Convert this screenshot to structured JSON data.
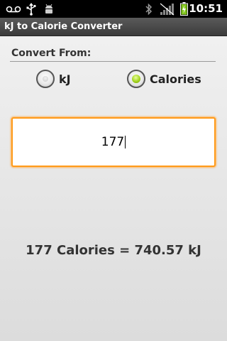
{
  "status_bar": {
    "time": "10:51",
    "icons": [
      "voicemail-icon",
      "usb-icon",
      "android-debug-icon",
      "bluetooth-icon",
      "signal-icon",
      "battery-charging-icon"
    ]
  },
  "app": {
    "title": "kJ to Calorie Converter"
  },
  "convert_from": {
    "label": "Convert From:",
    "options": [
      {
        "label": "kJ",
        "checked": false
      },
      {
        "label": "Calories",
        "checked": true
      }
    ]
  },
  "input": {
    "value": "177"
  },
  "result": {
    "text": "177 Calories = 740.57 kJ"
  },
  "colors": {
    "accent": "#ff9b1a",
    "radio_checked": "#a4d420"
  }
}
